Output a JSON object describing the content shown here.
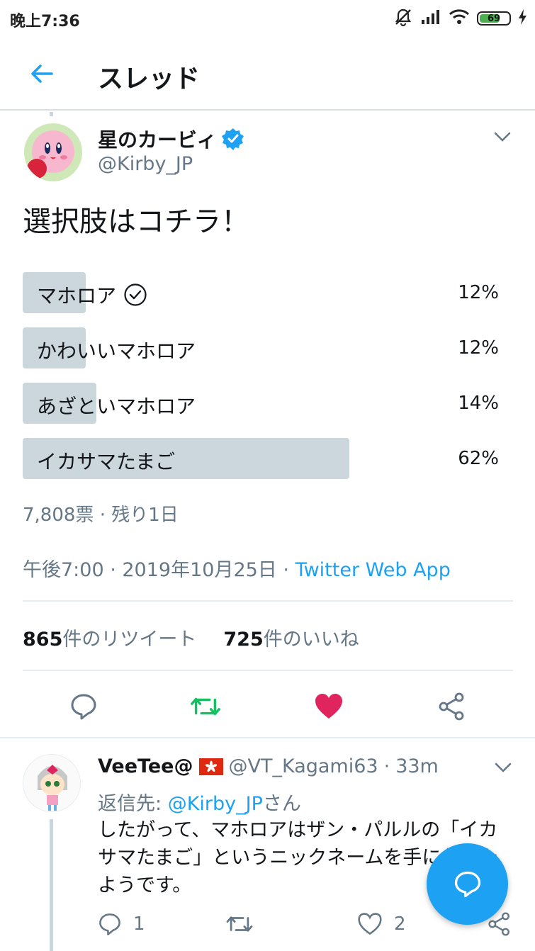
{
  "status_bar": {
    "time": "晚上7:36",
    "battery": "69",
    "battery_level": 0.69,
    "icons": [
      "mute-icon",
      "signal-icon",
      "wifi-icon",
      "battery-icon",
      "charging-icon"
    ]
  },
  "app_bar": {
    "title": "スレッド",
    "back_icon": "arrow-left-icon"
  },
  "tweet": {
    "author_name": "星のカービィ",
    "verified": true,
    "handle": "@Kirby_JP",
    "text": "選択肢はコチラ！",
    "poll": {
      "options": [
        {
          "label": "マホロア",
          "percent": "12%",
          "value": 0.12,
          "voted": true
        },
        {
          "label": "かわいいマホロア",
          "percent": "12%",
          "value": 0.12,
          "voted": false
        },
        {
          "label": "あざといマホロア",
          "percent": "14%",
          "value": 0.14,
          "voted": false
        },
        {
          "label": "イカサマたまご",
          "percent": "62%",
          "value": 0.62,
          "voted": false
        }
      ],
      "meta": "7,808票 · 残り1日"
    },
    "timestamp": "午後7:00 · 2019年10月25日 · ",
    "source": "Twitter Web App",
    "retweet_count": "865",
    "retweet_label": "件のリツイート",
    "like_count": "725",
    "like_label": "件のいいね",
    "colors": {
      "accent": "#1da1f2",
      "retweet": "#17bf63",
      "like": "#e0245e",
      "poll_bar": "#ccd6dd"
    }
  },
  "reply": {
    "author_name": "VeeTee@",
    "handle": "@VT_Kagami63",
    "time_sep": " · ",
    "time": "33m",
    "reply_to_prefix": "返信先: ",
    "reply_to_mention": "@Kirby_JP",
    "reply_to_suffix": "さん",
    "text": "したがって、マホロアはザン・パルルの「イカサマたまご」というニックネームを手に入れたようです。",
    "reply_count": "1",
    "like_count": "2"
  },
  "fab": {
    "icon": "compose-reply-icon"
  }
}
